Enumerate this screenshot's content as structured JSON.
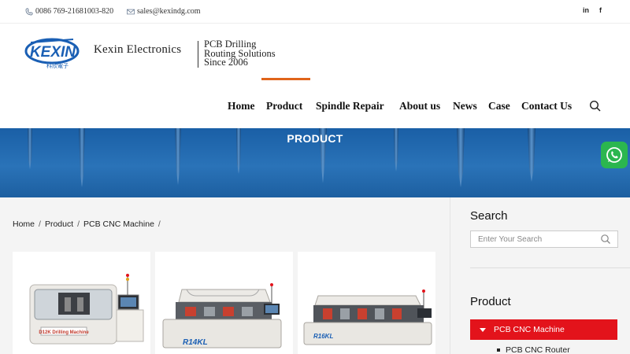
{
  "topbar": {
    "phone": "0086 769-21681003-820",
    "email": "sales@kexindg.com",
    "social": [
      {
        "label": "in",
        "icon": "linkedin-icon"
      },
      {
        "label": "f",
        "icon": "facebook-icon"
      }
    ]
  },
  "header": {
    "logo_text": "KEXIN",
    "logo_sub": "科欣電子",
    "brand": "Kexin Electronics",
    "tagline": [
      "PCB Drilling",
      "Routing Solutions",
      "Since 2006"
    ]
  },
  "nav": {
    "items": [
      {
        "label": "Home"
      },
      {
        "label": "Product",
        "active": true
      },
      {
        "label": "Spindle Repair"
      },
      {
        "label": "About us"
      },
      {
        "label": "News"
      },
      {
        "label": "Case"
      },
      {
        "label": "Contact Us"
      }
    ],
    "accent_color": "#e0641a"
  },
  "banner": {
    "title": "PRODUCT"
  },
  "breadcrumb": {
    "items": [
      "Home",
      "Product",
      "PCB CNC Machine"
    ],
    "separator": "/"
  },
  "products": [
    {
      "model_label": "D12K Drilling Machine",
      "icon": "drilling-machine-image"
    },
    {
      "model_label": "R14KL",
      "icon": "routing-machine-image"
    },
    {
      "model_label": "R16KL",
      "icon": "routing-machine-image"
    }
  ],
  "sidebar": {
    "search_heading": "Search",
    "search_placeholder": "Enter Your Search",
    "product_heading": "Product",
    "active_category": "PCB CNC Machine",
    "sub_items": [
      "PCB CNC Router"
    ],
    "active_color": "#e3131b"
  },
  "whatsapp": {
    "icon": "whatsapp-icon",
    "color": "#2bb64f"
  }
}
